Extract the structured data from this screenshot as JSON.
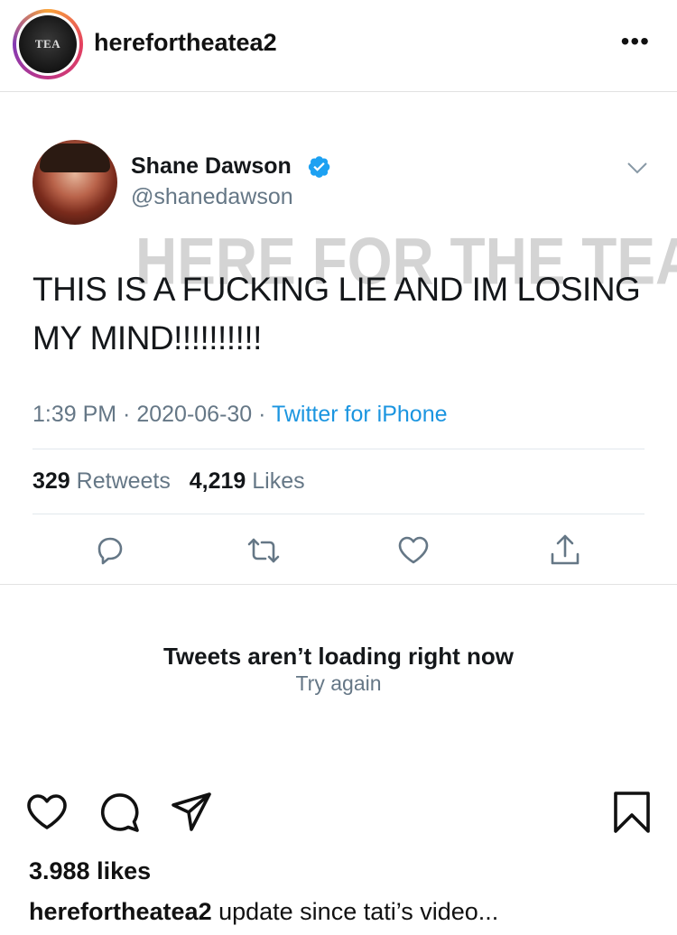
{
  "instagram": {
    "username": "herefortheatea2",
    "avatar_text": "TEA",
    "more_icon": "•••",
    "likes": "3.988 likes",
    "caption_user": "herefortheatea2",
    "caption_text": " update since tati’s video..."
  },
  "tweet": {
    "name": "Shane Dawson",
    "handle": "@shanedawson",
    "watermark": "HERE FOR THE TEA",
    "text": "THIS IS A FUCKING LIE AND IM LOSING MY MIND!!!!!!!!!!",
    "time": "1:39 PM",
    "date": "2020-06-30",
    "separator": " · ",
    "source": "Twitter for iPhone",
    "retweets_count": "329",
    "retweets_label": " Retweets",
    "likes_count": "4,219",
    "likes_label": " Likes"
  },
  "error": {
    "title": "Tweets aren’t loading right now",
    "retry": "Try again"
  },
  "colors": {
    "twitter_blue": "#1b95e0",
    "gray_text": "#657786",
    "verified": "#1da1f2"
  }
}
